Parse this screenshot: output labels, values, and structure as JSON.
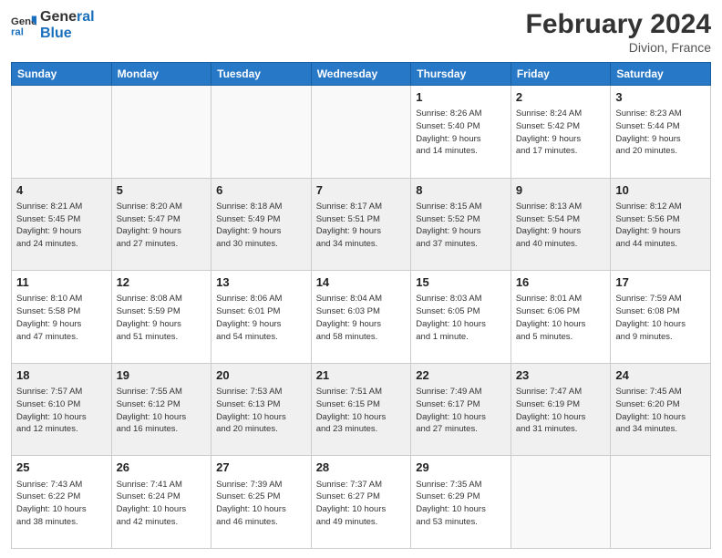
{
  "header": {
    "logo_line1": "General",
    "logo_line2": "Blue",
    "month_year": "February 2024",
    "location": "Divion, France"
  },
  "weekdays": [
    "Sunday",
    "Monday",
    "Tuesday",
    "Wednesday",
    "Thursday",
    "Friday",
    "Saturday"
  ],
  "weeks": [
    [
      {
        "day": "",
        "info": ""
      },
      {
        "day": "",
        "info": ""
      },
      {
        "day": "",
        "info": ""
      },
      {
        "day": "",
        "info": ""
      },
      {
        "day": "1",
        "info": "Sunrise: 8:26 AM\nSunset: 5:40 PM\nDaylight: 9 hours\nand 14 minutes."
      },
      {
        "day": "2",
        "info": "Sunrise: 8:24 AM\nSunset: 5:42 PM\nDaylight: 9 hours\nand 17 minutes."
      },
      {
        "day": "3",
        "info": "Sunrise: 8:23 AM\nSunset: 5:44 PM\nDaylight: 9 hours\nand 20 minutes."
      }
    ],
    [
      {
        "day": "4",
        "info": "Sunrise: 8:21 AM\nSunset: 5:45 PM\nDaylight: 9 hours\nand 24 minutes."
      },
      {
        "day": "5",
        "info": "Sunrise: 8:20 AM\nSunset: 5:47 PM\nDaylight: 9 hours\nand 27 minutes."
      },
      {
        "day": "6",
        "info": "Sunrise: 8:18 AM\nSunset: 5:49 PM\nDaylight: 9 hours\nand 30 minutes."
      },
      {
        "day": "7",
        "info": "Sunrise: 8:17 AM\nSunset: 5:51 PM\nDaylight: 9 hours\nand 34 minutes."
      },
      {
        "day": "8",
        "info": "Sunrise: 8:15 AM\nSunset: 5:52 PM\nDaylight: 9 hours\nand 37 minutes."
      },
      {
        "day": "9",
        "info": "Sunrise: 8:13 AM\nSunset: 5:54 PM\nDaylight: 9 hours\nand 40 minutes."
      },
      {
        "day": "10",
        "info": "Sunrise: 8:12 AM\nSunset: 5:56 PM\nDaylight: 9 hours\nand 44 minutes."
      }
    ],
    [
      {
        "day": "11",
        "info": "Sunrise: 8:10 AM\nSunset: 5:58 PM\nDaylight: 9 hours\nand 47 minutes."
      },
      {
        "day": "12",
        "info": "Sunrise: 8:08 AM\nSunset: 5:59 PM\nDaylight: 9 hours\nand 51 minutes."
      },
      {
        "day": "13",
        "info": "Sunrise: 8:06 AM\nSunset: 6:01 PM\nDaylight: 9 hours\nand 54 minutes."
      },
      {
        "day": "14",
        "info": "Sunrise: 8:04 AM\nSunset: 6:03 PM\nDaylight: 9 hours\nand 58 minutes."
      },
      {
        "day": "15",
        "info": "Sunrise: 8:03 AM\nSunset: 6:05 PM\nDaylight: 10 hours\nand 1 minute."
      },
      {
        "day": "16",
        "info": "Sunrise: 8:01 AM\nSunset: 6:06 PM\nDaylight: 10 hours\nand 5 minutes."
      },
      {
        "day": "17",
        "info": "Sunrise: 7:59 AM\nSunset: 6:08 PM\nDaylight: 10 hours\nand 9 minutes."
      }
    ],
    [
      {
        "day": "18",
        "info": "Sunrise: 7:57 AM\nSunset: 6:10 PM\nDaylight: 10 hours\nand 12 minutes."
      },
      {
        "day": "19",
        "info": "Sunrise: 7:55 AM\nSunset: 6:12 PM\nDaylight: 10 hours\nand 16 minutes."
      },
      {
        "day": "20",
        "info": "Sunrise: 7:53 AM\nSunset: 6:13 PM\nDaylight: 10 hours\nand 20 minutes."
      },
      {
        "day": "21",
        "info": "Sunrise: 7:51 AM\nSunset: 6:15 PM\nDaylight: 10 hours\nand 23 minutes."
      },
      {
        "day": "22",
        "info": "Sunrise: 7:49 AM\nSunset: 6:17 PM\nDaylight: 10 hours\nand 27 minutes."
      },
      {
        "day": "23",
        "info": "Sunrise: 7:47 AM\nSunset: 6:19 PM\nDaylight: 10 hours\nand 31 minutes."
      },
      {
        "day": "24",
        "info": "Sunrise: 7:45 AM\nSunset: 6:20 PM\nDaylight: 10 hours\nand 34 minutes."
      }
    ],
    [
      {
        "day": "25",
        "info": "Sunrise: 7:43 AM\nSunset: 6:22 PM\nDaylight: 10 hours\nand 38 minutes."
      },
      {
        "day": "26",
        "info": "Sunrise: 7:41 AM\nSunset: 6:24 PM\nDaylight: 10 hours\nand 42 minutes."
      },
      {
        "day": "27",
        "info": "Sunrise: 7:39 AM\nSunset: 6:25 PM\nDaylight: 10 hours\nand 46 minutes."
      },
      {
        "day": "28",
        "info": "Sunrise: 7:37 AM\nSunset: 6:27 PM\nDaylight: 10 hours\nand 49 minutes."
      },
      {
        "day": "29",
        "info": "Sunrise: 7:35 AM\nSunset: 6:29 PM\nDaylight: 10 hours\nand 53 minutes."
      },
      {
        "day": "",
        "info": ""
      },
      {
        "day": "",
        "info": ""
      }
    ]
  ]
}
